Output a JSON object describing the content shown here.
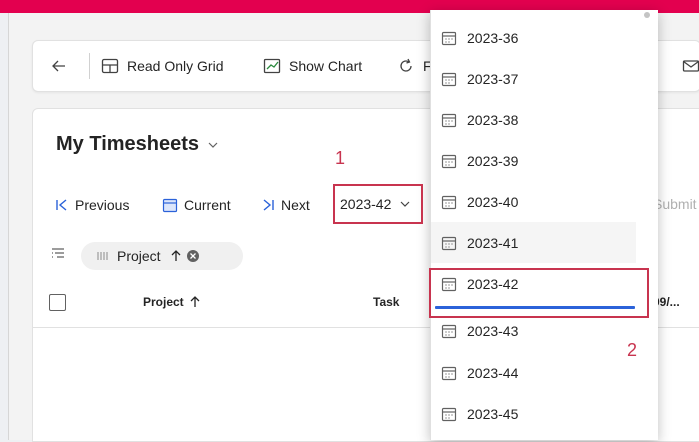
{
  "colors": {
    "accent_bar": "#e3004f",
    "annotation": "#c8344f",
    "selection_bar": "#2b62d9"
  },
  "command_bar": {
    "back_icon": "arrow-left-icon",
    "read_only_grid": "Read Only Grid",
    "show_chart": "Show Chart",
    "refresh_fragment": "F"
  },
  "view": {
    "title": "My Timesheets"
  },
  "nav": {
    "previous": "Previous",
    "current": "Current",
    "next": "Next",
    "selected_week": "2023-42",
    "submit_fragment": "Submit"
  },
  "filter": {
    "chip_label": "Project"
  },
  "grid": {
    "columns": [
      "Project",
      "Task",
      "09/..."
    ]
  },
  "dropdown": {
    "options": [
      "2023-36",
      "2023-37",
      "2023-38",
      "2023-39",
      "2023-40",
      "2023-41",
      "2023-42",
      "2023-43",
      "2023-44",
      "2023-45"
    ],
    "hovered": "2023-41",
    "selected": "2023-42"
  },
  "annotations": {
    "step1": "1",
    "step2": "2"
  }
}
